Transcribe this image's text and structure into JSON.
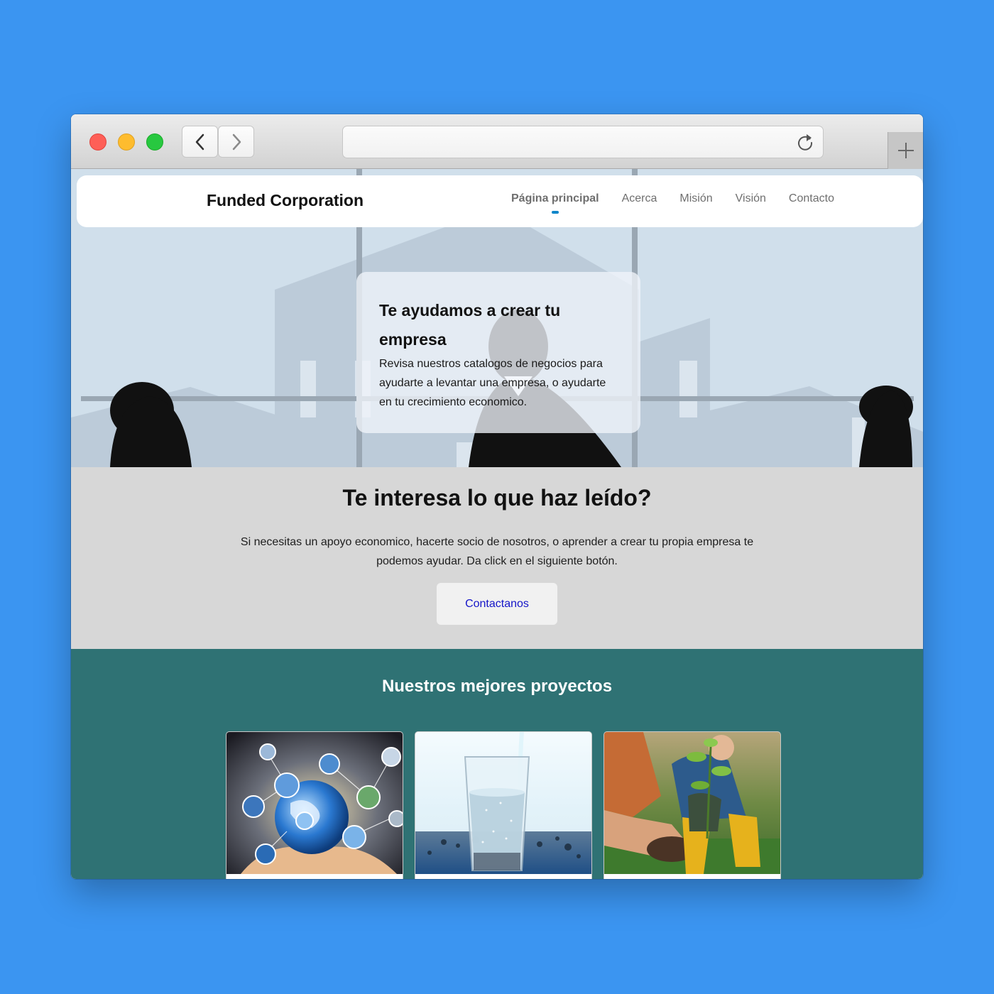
{
  "browser": {
    "url": "",
    "controls": {
      "back": "back-icon",
      "forward": "forward-icon",
      "reload": "reload-icon",
      "new_tab": "plus-icon"
    }
  },
  "navbar": {
    "brand": "Funded Corporation",
    "links": [
      "Página principal",
      "Acerca",
      "Misión",
      "Visión",
      "Contacto"
    ],
    "active_index": 0
  },
  "hero": {
    "title": "Te ayudamos a crear tu empresa",
    "text": "Revisa nuestros catalogos de negocios para ayudarte a levantar una empresa, o ayudarte en tu crecimiento economico."
  },
  "interest": {
    "title": "Te interesa lo que haz leído?",
    "text": "Si necesitas un apoyo economico, hacerte socio de nosotros, o aprender a crear tu propia empresa te podemos ayudar. Da click en el siguiente botón.",
    "button": "Contactanos"
  },
  "projects": {
    "title": "Nuestros mejores proyectos",
    "cards": [
      {
        "image": "globe-network-in-hands-photo"
      },
      {
        "image": "glass-of-water-photo"
      },
      {
        "image": "planting-seedling-photo"
      }
    ]
  },
  "colors": {
    "page_background": "#3b95f1",
    "projects_background": "#2f7274",
    "interest_background": "#d7d7d7",
    "nav_active_indicator": "#0f86c9",
    "button_text": "#1515c8"
  }
}
